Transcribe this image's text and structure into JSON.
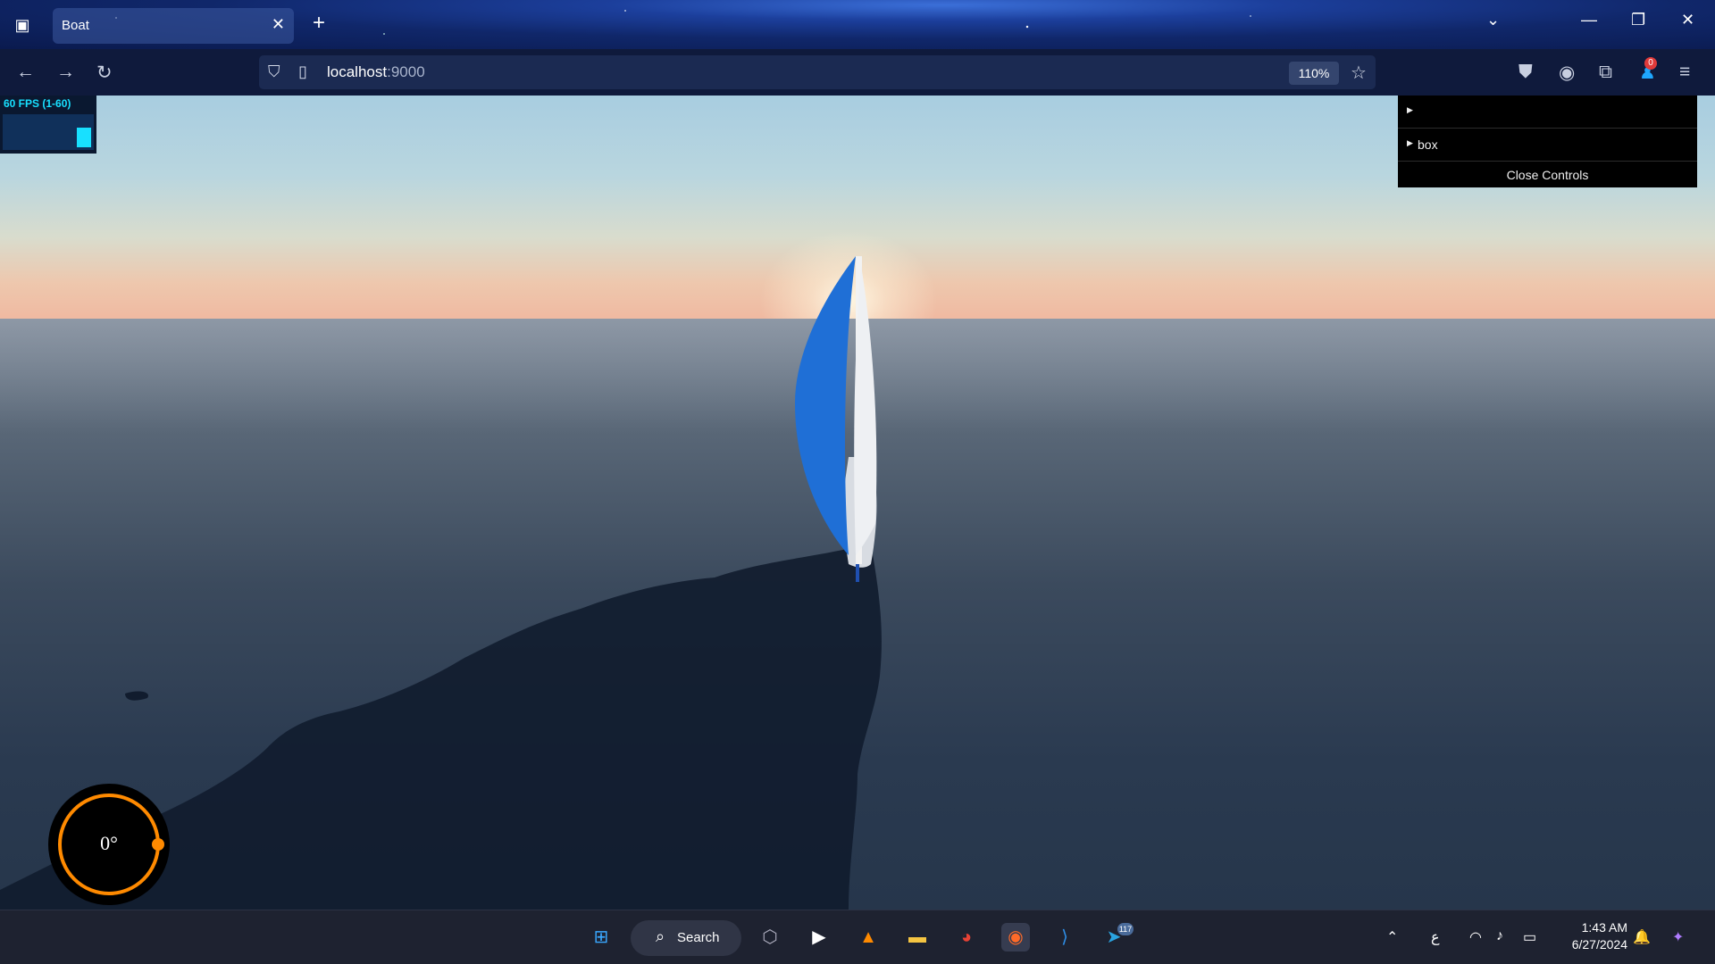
{
  "browser": {
    "tab_title": "Boat",
    "tab_close": "✕",
    "new_tab": "+",
    "url_host": "localhost",
    "url_port": ":9000",
    "zoom": "110%",
    "notification_count": "0"
  },
  "scene": {
    "fps_label": "60 FPS (1-60)",
    "gui": {
      "folder_1_label": "",
      "folder_2_label": "box",
      "close_label": "Close Controls"
    },
    "compass_heading": "0°"
  },
  "taskbar": {
    "search_label": "Search",
    "telegram_badge": "117",
    "ime_indicator": "ع",
    "time": "1:43 AM",
    "date": "6/27/2024"
  },
  "colors": {
    "accent_orange": "#ff8a00",
    "fps_cyan": "#18e0ff",
    "sail_blue": "#1f6fd6"
  }
}
